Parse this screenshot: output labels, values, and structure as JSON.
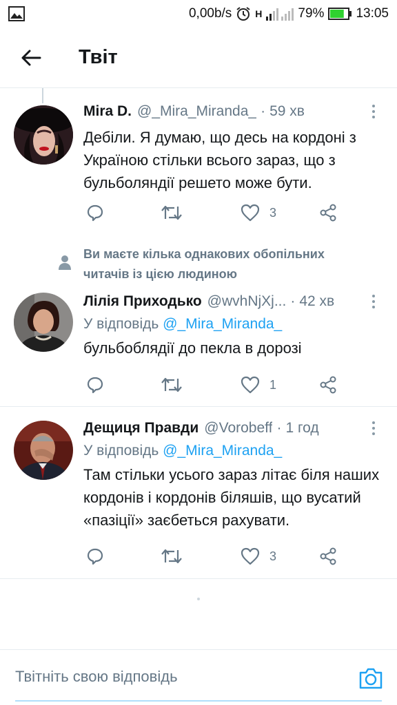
{
  "status_bar": {
    "net_speed": "0,00b/s",
    "net_label": "H",
    "battery_percent": "79%",
    "time": "13:05",
    "battery_level": 0.79
  },
  "header": {
    "title": "Твіт"
  },
  "tweets": [
    {
      "name": "Mira D.",
      "handle": "@_Mira_Miranda_",
      "separator": "·",
      "time": "59 хв",
      "reply_label": "",
      "reply_to": "",
      "text": "Дебіли. Я думаю, що десь на кордоні з Україною стільки всього зараз, що з бульболяндії решето може бути.",
      "likes": "3"
    },
    {
      "name": "Лілія Приходько",
      "handle": "@wvhNjXj...",
      "separator": "·",
      "time": "42 хв",
      "reply_label": "У відповідь",
      "reply_to": "@_Mira_Miranda_",
      "text": "бульбоблядії до пекла в дорозі",
      "likes": "1"
    },
    {
      "name": "Дещиця Правди",
      "handle": "@Vorobeff",
      "separator": "·",
      "time": "1 год",
      "reply_label": "У відповідь",
      "reply_to": "@_Mira_Miranda_",
      "text": "Там стільки усього зараз літає біля наших кордонів і кордонів біляшів, що вусатий «пазіції» заєбеться рахувати.",
      "likes": "3"
    }
  ],
  "social_context": "Ви маєте кілька однакових обопільних читачів із цією людиною",
  "reply_bar": {
    "placeholder": "Твітніть свою відповідь"
  },
  "colors": {
    "accent": "#1da1f2",
    "muted": "#657786",
    "text": "#14171a",
    "divider": "#e6ecf0",
    "battery": "#2fd12f"
  },
  "icons": [
    "image-icon",
    "alarm-icon",
    "signal-icon",
    "battery-icon",
    "back-arrow-icon",
    "more-icon",
    "reply-icon",
    "retweet-icon",
    "like-icon",
    "share-icon",
    "person-icon",
    "camera-icon"
  ]
}
